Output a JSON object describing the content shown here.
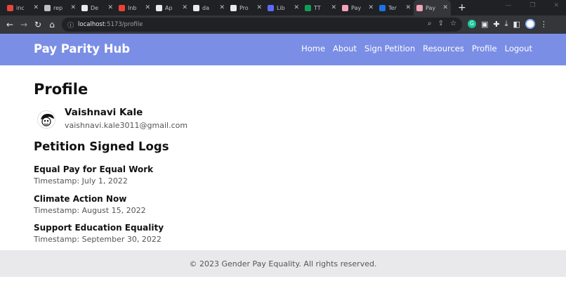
{
  "browser": {
    "tabs": [
      {
        "label": "inc",
        "color": "#e8453c"
      },
      {
        "label": "rep",
        "color": "#bdc1c6"
      },
      {
        "label": "De",
        "color": "#e8eaed"
      },
      {
        "label": "Inb",
        "color": "#ea4335"
      },
      {
        "label": "Ap",
        "color": "#e8eaed"
      },
      {
        "label": "da",
        "color": "#e8eaed"
      },
      {
        "label": "Pro",
        "color": "#e8eaed"
      },
      {
        "label": "Lib",
        "color": "#5b6cf9"
      },
      {
        "label": "TT",
        "color": "#0f9d58"
      },
      {
        "label": "Pay",
        "color": "#f5a3b8"
      },
      {
        "label": "Ter",
        "color": "#1a73e8"
      },
      {
        "label": "Pay",
        "color": "#f5a3b8",
        "active": true
      }
    ],
    "url_host": "localhost",
    "url_path": ":5173/profile"
  },
  "header": {
    "brand": "Pay Parity Hub",
    "nav": [
      "Home",
      "About",
      "Sign Petition",
      "Resources",
      "Profile",
      "Logout"
    ]
  },
  "profile": {
    "title": "Profile",
    "name": "Vaishnavi Kale",
    "email": "vaishnavi.kale3011@gmail.com"
  },
  "logs": {
    "title": "Petition Signed Logs",
    "items": [
      {
        "title": "Equal Pay for Equal Work",
        "timestamp": "Timestamp: July 1, 2022"
      },
      {
        "title": "Climate Action Now",
        "timestamp": "Timestamp: August 15, 2022"
      },
      {
        "title": "Support Education Equality",
        "timestamp": "Timestamp: September 30, 2022"
      }
    ]
  },
  "footer": {
    "text": "© 2023 Gender Pay Equality. All rights reserved."
  }
}
